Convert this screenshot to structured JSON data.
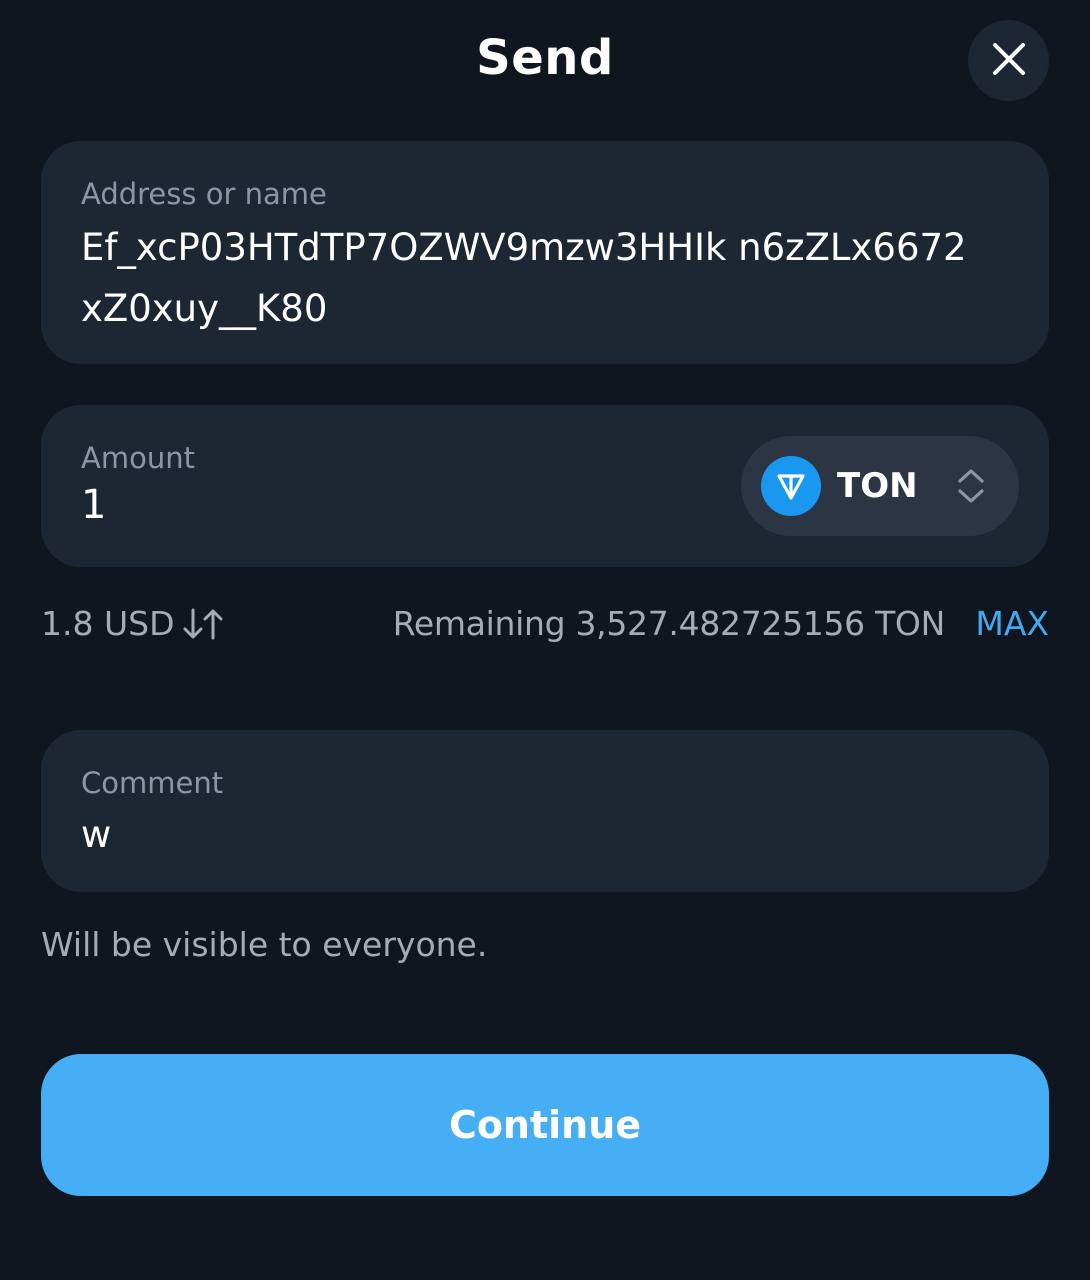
{
  "header": {
    "title": "Send",
    "close_icon": "close-icon"
  },
  "address": {
    "label": "Address or name",
    "value": "Ef_xcP03HTdTP7OZWV9mzw3HHIk n6zZLx6672xZ0xuy__K80"
  },
  "amount": {
    "label": "Amount",
    "value": "1",
    "token": {
      "name": "TON",
      "icon": "ton-logo-icon",
      "chevron_icon": "chevron-up-down-icon"
    }
  },
  "info": {
    "fiat_value": "1.8 USD",
    "swap_icon": "swap-arrows-icon",
    "remaining": "Remaining 3,527.482725156 TON",
    "max_label": "MAX"
  },
  "comment": {
    "label": "Comment",
    "value": "w",
    "hint": "Will be visible to everyone."
  },
  "footer": {
    "continue_label": "Continue"
  },
  "colors": {
    "background": "#10161f",
    "card": "#1d2633",
    "accent": "#46aef4",
    "link": "#45a8ef",
    "muted_text": "#a3adba"
  }
}
